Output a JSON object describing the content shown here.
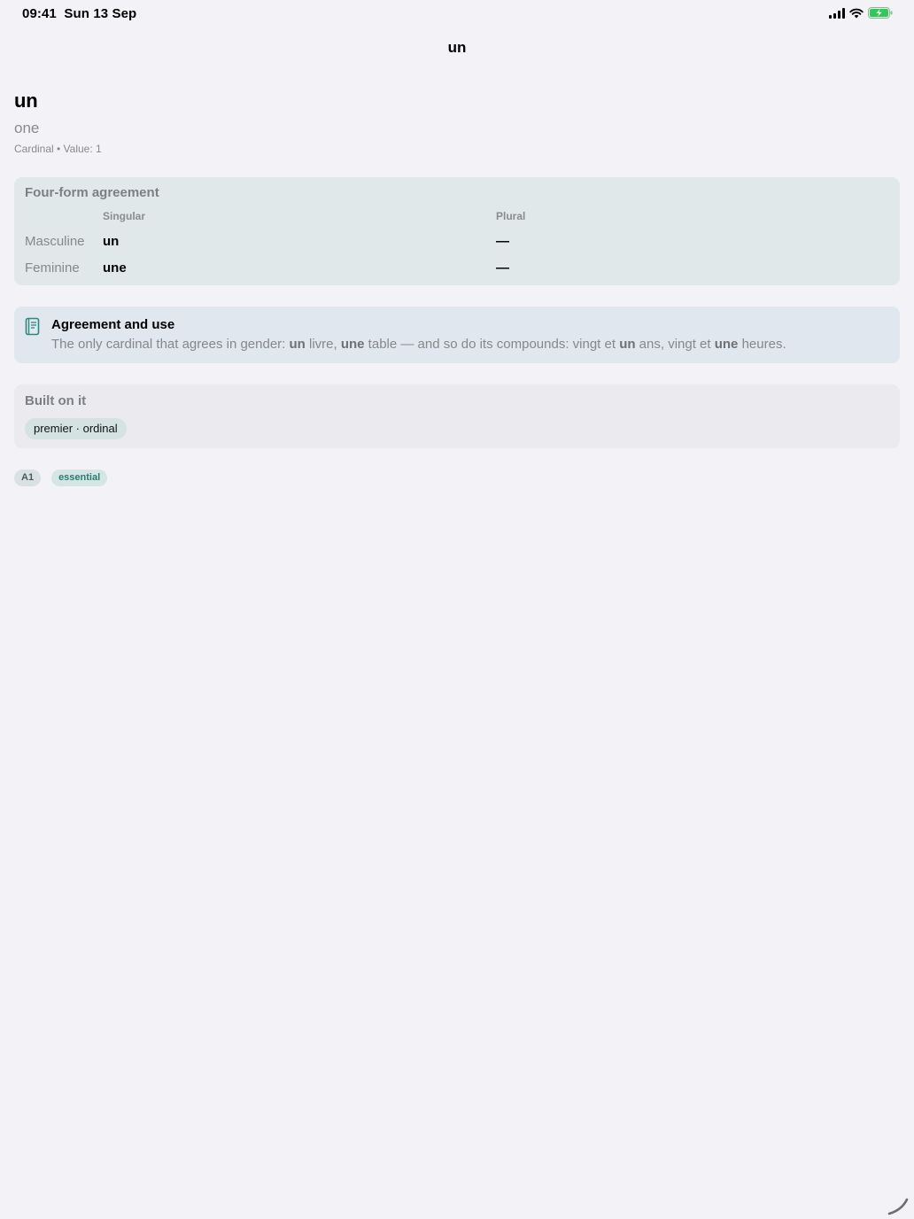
{
  "status_bar": {
    "time": "09:41",
    "date": "Sun 13 Sep",
    "battery_color": "#34c759"
  },
  "nav": {
    "title": "un"
  },
  "word": {
    "headword": "un",
    "translation": "one",
    "meta": "Cardinal • Value: 1"
  },
  "agreement": {
    "heading": "Four-form agreement",
    "columns": [
      "Singular",
      "Plural"
    ],
    "rows": [
      {
        "label": "Masculine",
        "singular": "un",
        "plural": "—"
      },
      {
        "label": "Feminine",
        "singular": "une",
        "plural": "—"
      }
    ]
  },
  "note": {
    "icon": "book-icon",
    "accent_color": "#2c8a80",
    "title": "Agreement and use",
    "body_parts": [
      {
        "text": "The only cardinal that agrees in gender: ",
        "bold": false
      },
      {
        "text": "un",
        "bold": true
      },
      {
        "text": " livre, ",
        "bold": false
      },
      {
        "text": "une",
        "bold": true
      },
      {
        "text": " table — and so do its compounds: vingt et ",
        "bold": false
      },
      {
        "text": "un",
        "bold": true
      },
      {
        "text": " ans, vingt et ",
        "bold": false
      },
      {
        "text": "une",
        "bold": true
      },
      {
        "text": " heures.",
        "bold": false
      }
    ]
  },
  "built_on": {
    "heading": "Built on it",
    "items": [
      "premier · ordinal"
    ]
  },
  "tags": {
    "level": "A1",
    "category": "essential"
  }
}
